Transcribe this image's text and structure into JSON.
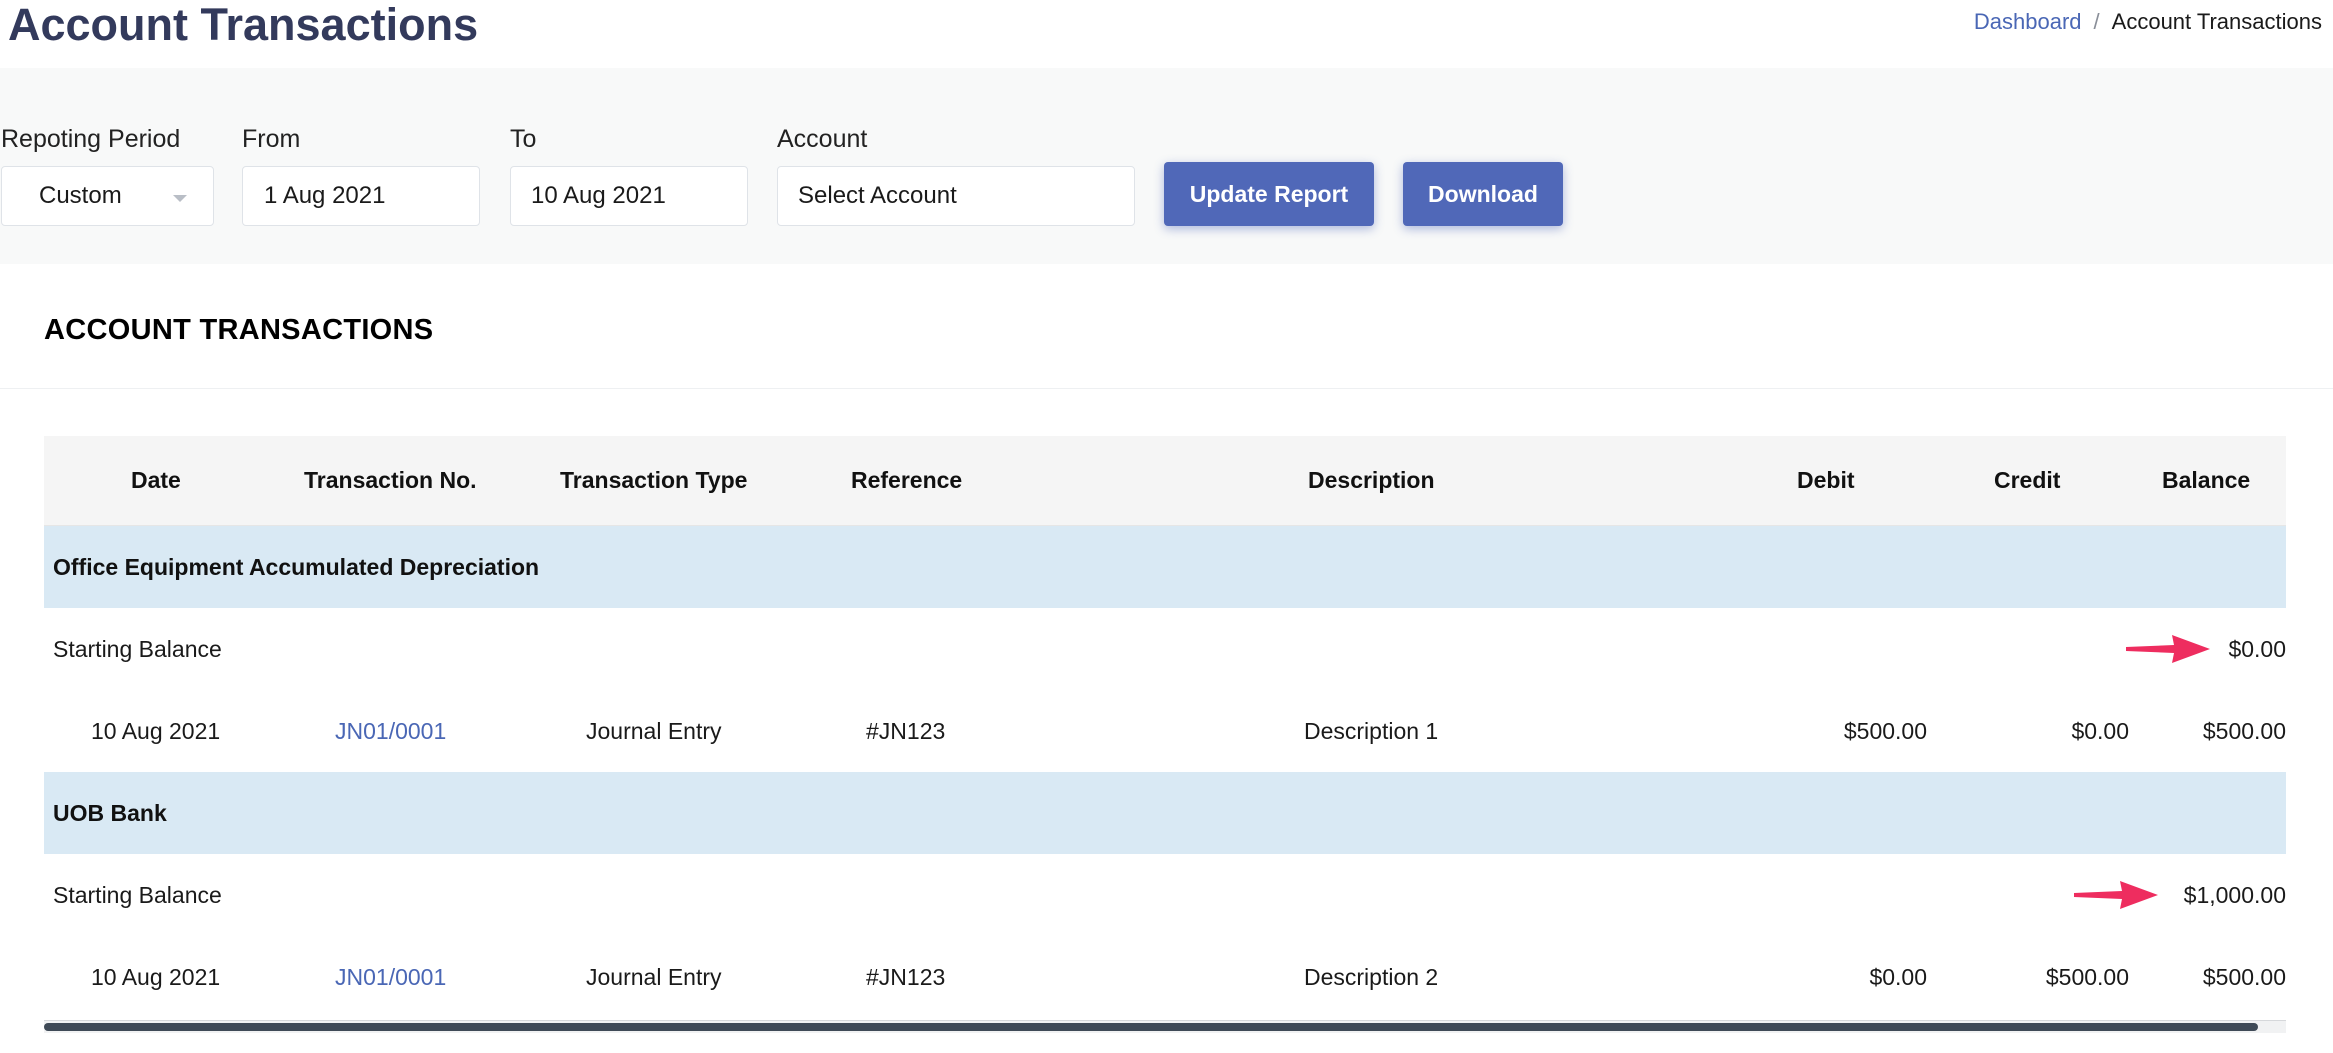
{
  "page": {
    "title": "Account Transactions",
    "breadcrumb": {
      "link": "Dashboard",
      "separator": "/",
      "current": "Account Transactions"
    }
  },
  "filters": {
    "period": {
      "label": "Repoting Period",
      "value": "Custom"
    },
    "from": {
      "label": "From",
      "value": "1 Aug 2021"
    },
    "to": {
      "label": "To",
      "value": "10 Aug 2021"
    },
    "account": {
      "label": "Account",
      "value": "Select Account"
    },
    "update_label": "Update Report",
    "download_label": "Download"
  },
  "section": {
    "title": "ACCOUNT TRANSACTIONS"
  },
  "table": {
    "headers": [
      "Date",
      "Transaction No.",
      "Transaction Type",
      "Reference",
      "Description",
      "Debit",
      "Credit",
      "Balance"
    ],
    "groups": [
      {
        "name": "Office Equipment Accumulated Depreciation",
        "starting_label": "Starting Balance",
        "starting_balance": "$0.00",
        "rows": [
          {
            "date": "10 Aug 2021",
            "txn": "JN01/0001",
            "type": "Journal Entry",
            "ref": "#JN123",
            "desc": "Description 1",
            "debit": "$500.00",
            "credit": "$0.00",
            "balance": "$500.00"
          }
        ]
      },
      {
        "name": "UOB Bank",
        "starting_label": "Starting Balance",
        "starting_balance": "$1,000.00",
        "rows": [
          {
            "date": "10 Aug 2021",
            "txn": "JN01/0001",
            "type": "Journal Entry",
            "ref": "#JN123",
            "desc": "Description 2",
            "debit": "$0.00",
            "credit": "$500.00",
            "balance": "$500.00"
          }
        ]
      }
    ]
  },
  "colors": {
    "title": "#333a5c",
    "accent": "#5068b8",
    "link": "#4a67b5",
    "group_row": "#d9e9f4",
    "annotation_arrow": "#ee2d5f"
  },
  "icons": {
    "period_dropdown": "chevron-down-icon",
    "annotation": "arrow-right-icon"
  }
}
